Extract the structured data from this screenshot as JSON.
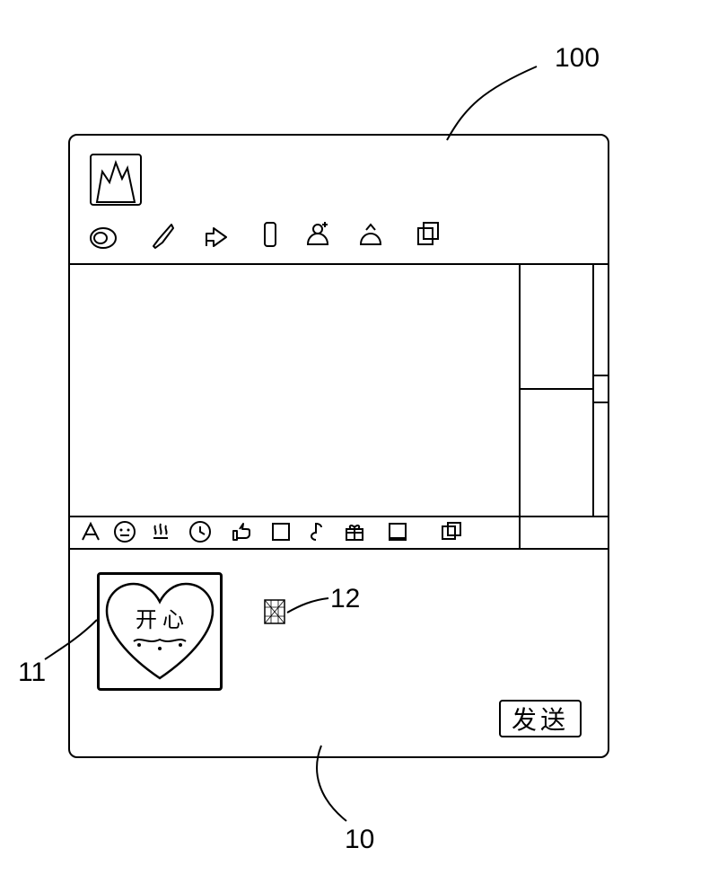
{
  "callouts": {
    "main_window": "100",
    "sticker_preview": "11",
    "cursor": "12",
    "input_area": "10"
  },
  "toolbar_top_icons": [
    "ring-icon",
    "brush-icon",
    "share-icon",
    "phone-icon",
    "add-contact-icon",
    "receive-icon",
    "copy-icon"
  ],
  "toolbar_input_icons": [
    "font-icon",
    "emoji-icon",
    "hot-icon",
    "clock-icon",
    "thumb-icon",
    "square-icon",
    "music-icon",
    "gift-icon",
    "window-icon",
    "windows-icon"
  ],
  "input_area": {
    "sticker_text": "开心",
    "cursor_visible": true,
    "send_button_label": "发送"
  }
}
